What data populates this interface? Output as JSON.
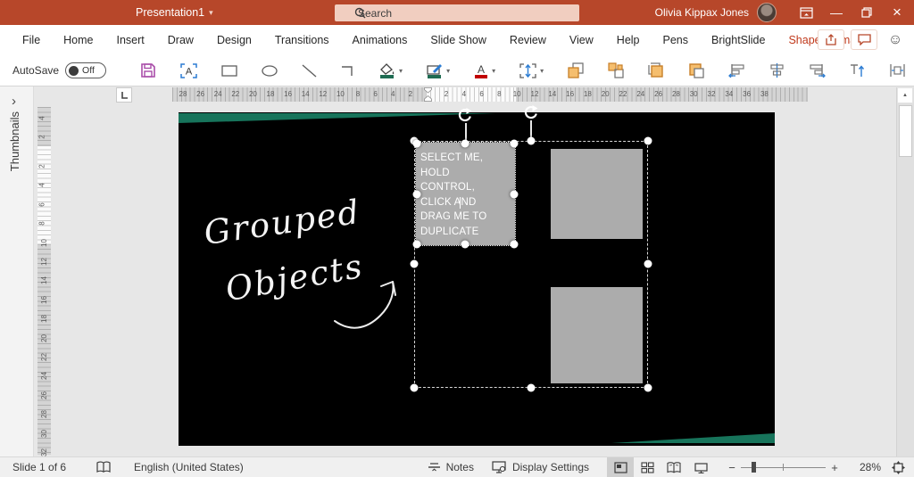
{
  "title_bar": {
    "document_title": "Presentation1",
    "search_placeholder": "Search",
    "user_name": "Olivia Kippax Jones",
    "bg_color": "#B7472A"
  },
  "menu_bar": {
    "items": [
      "File",
      "Home",
      "Insert",
      "Draw",
      "Design",
      "Transitions",
      "Animations",
      "Slide Show",
      "Review",
      "View",
      "Help",
      "Pens",
      "BrightSlide",
      "Shape Format"
    ],
    "active_item": "Shape Format",
    "active_color": "#C0391B"
  },
  "toolbar": {
    "autosave_label": "AutoSave",
    "autosave_state": "Off"
  },
  "thumbnails_panel": {
    "label": "Thumbnails"
  },
  "rulers": {
    "horizontal_left": [
      "28",
      "26",
      "24",
      "22",
      "20",
      "18",
      "16",
      "14",
      "12",
      "10",
      "8",
      "6",
      "4",
      "2"
    ],
    "horizontal_right": [
      "2",
      "4",
      "6",
      "8",
      "10",
      "12",
      "14",
      "16",
      "18",
      "20",
      "22",
      "24",
      "26",
      "28",
      "30",
      "32",
      "34",
      "36",
      "38"
    ],
    "vertical_top": [
      "4",
      "2"
    ],
    "vertical_bottom": [
      "2",
      "4",
      "6",
      "8",
      "10",
      "12",
      "14",
      "16",
      "18",
      "20",
      "22",
      "24",
      "26",
      "28",
      "30",
      "32"
    ]
  },
  "slide": {
    "background": "#000000",
    "corner_accent_color": "#17745B",
    "shape_fill_color": "#ACACAC",
    "handwriting": {
      "line1": "Grouped",
      "line2": "Objects"
    },
    "group_textbox_lines": [
      "SELECT ME,",
      "HOLD",
      "CONTROL,",
      "CLICK AND",
      "DRAG ME TO",
      "DUPLICATE"
    ]
  },
  "status_bar": {
    "slide_indicator": "Slide 1 of 6",
    "language": "English (United States)",
    "notes_label": "Notes",
    "display_settings_label": "Display Settings",
    "zoom_percent": "28%"
  },
  "icons": {
    "dropdown": "▾",
    "chevron_right": "›",
    "minimize": "—",
    "close": "×",
    "smiley": "☺",
    "overflow": "»",
    "zoom_out": "−",
    "zoom_in": "+",
    "scroll_up": "▲"
  }
}
